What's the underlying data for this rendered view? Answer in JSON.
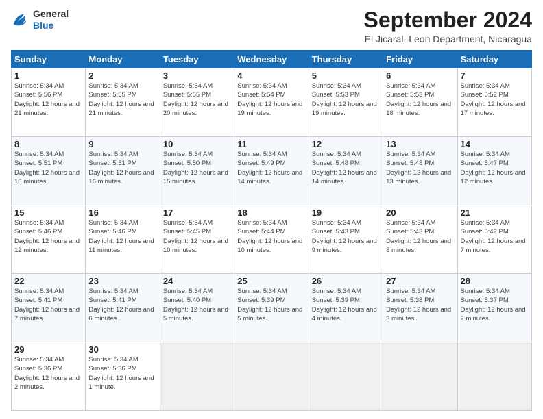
{
  "logo": {
    "general": "General",
    "blue": "Blue"
  },
  "title": "September 2024",
  "location": "El Jicaral, Leon Department, Nicaragua",
  "days_of_week": [
    "Sunday",
    "Monday",
    "Tuesday",
    "Wednesday",
    "Thursday",
    "Friday",
    "Saturday"
  ],
  "weeks": [
    [
      {
        "day": "1",
        "sunrise": "5:34 AM",
        "sunset": "5:56 PM",
        "daylight": "12 hours and 21 minutes."
      },
      {
        "day": "2",
        "sunrise": "5:34 AM",
        "sunset": "5:55 PM",
        "daylight": "12 hours and 21 minutes."
      },
      {
        "day": "3",
        "sunrise": "5:34 AM",
        "sunset": "5:55 PM",
        "daylight": "12 hours and 20 minutes."
      },
      {
        "day": "4",
        "sunrise": "5:34 AM",
        "sunset": "5:54 PM",
        "daylight": "12 hours and 19 minutes."
      },
      {
        "day": "5",
        "sunrise": "5:34 AM",
        "sunset": "5:53 PM",
        "daylight": "12 hours and 19 minutes."
      },
      {
        "day": "6",
        "sunrise": "5:34 AM",
        "sunset": "5:53 PM",
        "daylight": "12 hours and 18 minutes."
      },
      {
        "day": "7",
        "sunrise": "5:34 AM",
        "sunset": "5:52 PM",
        "daylight": "12 hours and 17 minutes."
      }
    ],
    [
      {
        "day": "8",
        "sunrise": "5:34 AM",
        "sunset": "5:51 PM",
        "daylight": "12 hours and 16 minutes."
      },
      {
        "day": "9",
        "sunrise": "5:34 AM",
        "sunset": "5:51 PM",
        "daylight": "12 hours and 16 minutes."
      },
      {
        "day": "10",
        "sunrise": "5:34 AM",
        "sunset": "5:50 PM",
        "daylight": "12 hours and 15 minutes."
      },
      {
        "day": "11",
        "sunrise": "5:34 AM",
        "sunset": "5:49 PM",
        "daylight": "12 hours and 14 minutes."
      },
      {
        "day": "12",
        "sunrise": "5:34 AM",
        "sunset": "5:48 PM",
        "daylight": "12 hours and 14 minutes."
      },
      {
        "day": "13",
        "sunrise": "5:34 AM",
        "sunset": "5:48 PM",
        "daylight": "12 hours and 13 minutes."
      },
      {
        "day": "14",
        "sunrise": "5:34 AM",
        "sunset": "5:47 PM",
        "daylight": "12 hours and 12 minutes."
      }
    ],
    [
      {
        "day": "15",
        "sunrise": "5:34 AM",
        "sunset": "5:46 PM",
        "daylight": "12 hours and 12 minutes."
      },
      {
        "day": "16",
        "sunrise": "5:34 AM",
        "sunset": "5:46 PM",
        "daylight": "12 hours and 11 minutes."
      },
      {
        "day": "17",
        "sunrise": "5:34 AM",
        "sunset": "5:45 PM",
        "daylight": "12 hours and 10 minutes."
      },
      {
        "day": "18",
        "sunrise": "5:34 AM",
        "sunset": "5:44 PM",
        "daylight": "12 hours and 10 minutes."
      },
      {
        "day": "19",
        "sunrise": "5:34 AM",
        "sunset": "5:43 PM",
        "daylight": "12 hours and 9 minutes."
      },
      {
        "day": "20",
        "sunrise": "5:34 AM",
        "sunset": "5:43 PM",
        "daylight": "12 hours and 8 minutes."
      },
      {
        "day": "21",
        "sunrise": "5:34 AM",
        "sunset": "5:42 PM",
        "daylight": "12 hours and 7 minutes."
      }
    ],
    [
      {
        "day": "22",
        "sunrise": "5:34 AM",
        "sunset": "5:41 PM",
        "daylight": "12 hours and 7 minutes."
      },
      {
        "day": "23",
        "sunrise": "5:34 AM",
        "sunset": "5:41 PM",
        "daylight": "12 hours and 6 minutes."
      },
      {
        "day": "24",
        "sunrise": "5:34 AM",
        "sunset": "5:40 PM",
        "daylight": "12 hours and 5 minutes."
      },
      {
        "day": "25",
        "sunrise": "5:34 AM",
        "sunset": "5:39 PM",
        "daylight": "12 hours and 5 minutes."
      },
      {
        "day": "26",
        "sunrise": "5:34 AM",
        "sunset": "5:39 PM",
        "daylight": "12 hours and 4 minutes."
      },
      {
        "day": "27",
        "sunrise": "5:34 AM",
        "sunset": "5:38 PM",
        "daylight": "12 hours and 3 minutes."
      },
      {
        "day": "28",
        "sunrise": "5:34 AM",
        "sunset": "5:37 PM",
        "daylight": "12 hours and 2 minutes."
      }
    ],
    [
      {
        "day": "29",
        "sunrise": "5:34 AM",
        "sunset": "5:36 PM",
        "daylight": "12 hours and 2 minutes."
      },
      {
        "day": "30",
        "sunrise": "5:34 AM",
        "sunset": "5:36 PM",
        "daylight": "12 hours and 1 minute."
      },
      null,
      null,
      null,
      null,
      null
    ]
  ]
}
